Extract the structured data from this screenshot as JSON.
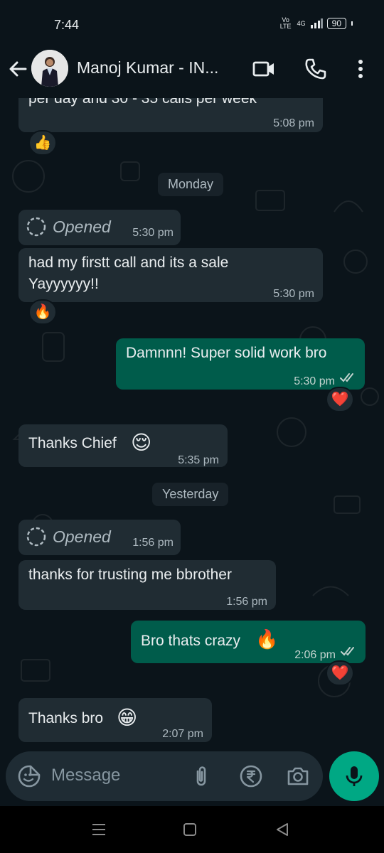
{
  "status": {
    "time": "7:44",
    "network": "Vo LTE",
    "signal": "4G",
    "battery": "90"
  },
  "header": {
    "contact_name": "Manoj Kumar - IN..."
  },
  "chat": {
    "messages": [
      {
        "direction": "in",
        "text": "per day and 30 - 35 calls per week",
        "time": "5:08 pm",
        "reaction": "👍"
      },
      {
        "type": "date",
        "label": "Monday"
      },
      {
        "direction": "in",
        "type": "view-once",
        "text": "Opened",
        "time": "5:30 pm"
      },
      {
        "direction": "in",
        "text_line1": "had my firstt call and its a sale",
        "text_line2": "Yayyyyyy!!",
        "time": "5:30 pm",
        "reaction": "🔥"
      },
      {
        "direction": "out",
        "text": "Damnnn! Super solid work bro",
        "time": "5:30 pm",
        "reaction": "❤️"
      },
      {
        "direction": "in",
        "text": "Thanks Chief",
        "emoji": "😌",
        "time": "5:35 pm"
      },
      {
        "type": "date",
        "label": "Yesterday"
      },
      {
        "direction": "in",
        "type": "view-once",
        "text": "Opened",
        "time": "1:56 pm"
      },
      {
        "direction": "in",
        "text": "thanks for trusting me bbrother",
        "time": "1:56 pm"
      },
      {
        "direction": "out",
        "text": "Bro thats crazy",
        "emoji": "🔥",
        "time": "2:06 pm",
        "reaction": "❤️"
      },
      {
        "direction": "in",
        "text": "Thanks bro",
        "emoji": "😁",
        "time": "2:07 pm"
      }
    ]
  },
  "composer": {
    "placeholder": "Message"
  },
  "colors": {
    "background": "#0b141a",
    "incoming_bubble": "#202c33",
    "outgoing_bubble": "#005c4b",
    "accent": "#00a884",
    "read_ticks": "#c3d3cf"
  },
  "icons": [
    "back-arrow-icon",
    "video-call-icon",
    "phone-icon",
    "more-options-icon",
    "sticker-icon",
    "attach-icon",
    "rupee-payment-icon",
    "camera-icon",
    "mic-icon",
    "nav-menu-icon",
    "nav-home-icon",
    "nav-back-icon"
  ]
}
